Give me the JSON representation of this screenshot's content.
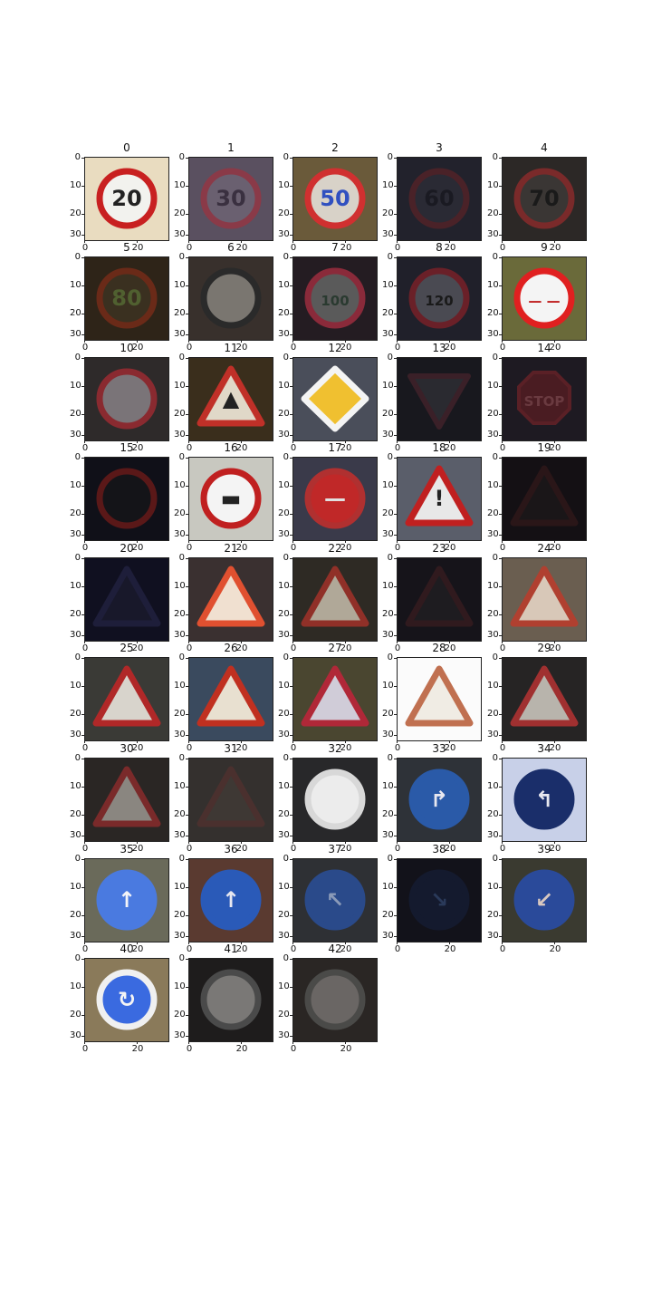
{
  "figure": {
    "yticks": [
      "0",
      "10",
      "20",
      "30"
    ],
    "xticks": [
      "0",
      "20"
    ]
  },
  "panels": [
    {
      "title": "0",
      "bg": "#e9dcc0",
      "shape": "circle",
      "rim": "#c82020",
      "fill": "#f2f2ee",
      "glyph": "20",
      "glyph_color": "#222222"
    },
    {
      "title": "1",
      "bg": "#5a5060",
      "shape": "circle",
      "rim": "#8a3a48",
      "fill": "#6a6070",
      "glyph": "30",
      "glyph_color": "#3a3040"
    },
    {
      "title": "2",
      "bg": "#6a5a3a",
      "shape": "circle",
      "rim": "#d03030",
      "fill": "#d8d2c8",
      "glyph": "50",
      "glyph_color": "#3050c0"
    },
    {
      "title": "3",
      "bg": "#22222c",
      "shape": "circle",
      "rim": "#4a2228",
      "fill": "#2a2a34",
      "glyph": "60",
      "glyph_color": "#1a1a22"
    },
    {
      "title": "4",
      "bg": "#2c2826",
      "shape": "circle",
      "rim": "#7a2a2a",
      "fill": "#3a3634",
      "glyph": "70",
      "glyph_color": "#1a1a1a"
    },
    {
      "title": "5",
      "bg": "#2e2418",
      "shape": "circle",
      "rim": "#6a2a18",
      "fill": "#3a3020",
      "glyph": "80",
      "glyph_color": "#506030"
    },
    {
      "title": "6",
      "bg": "#38302c",
      "shape": "circle",
      "rim": "#2a2a2a",
      "fill": "#7a7670",
      "glyph": "",
      "glyph_color": "#222222"
    },
    {
      "title": "7",
      "bg": "#241c22",
      "shape": "circle",
      "rim": "#8a2a3a",
      "fill": "#5a5a5a",
      "glyph": "100",
      "glyph_color": "#2a3a30"
    },
    {
      "title": "8",
      "bg": "#20202a",
      "shape": "circle",
      "rim": "#6a2028",
      "fill": "#4a4a52",
      "glyph": "120",
      "glyph_color": "#1a1a1a"
    },
    {
      "title": "9",
      "bg": "#6a6a3a",
      "shape": "circle",
      "rim": "#e02020",
      "fill": "#f4f4f4",
      "glyph": "— —",
      "glyph_color": "#c02020"
    },
    {
      "title": "10",
      "bg": "#2e2a2a",
      "shape": "circle",
      "rim": "#8a2a30",
      "fill": "#7a7478",
      "glyph": "",
      "glyph_color": "#222222"
    },
    {
      "title": "11",
      "bg": "#3a2e1c",
      "shape": "triangle",
      "rim": "#c03028",
      "fill": "#e0d8c8",
      "glyph": "▲",
      "glyph_color": "#222222"
    },
    {
      "title": "12",
      "bg": "#4a4e5a",
      "shape": "diamond",
      "rim": "#f4f4f4",
      "fill": "#f0c030",
      "glyph": "",
      "glyph_color": "#222222"
    },
    {
      "title": "13",
      "bg": "#18181e",
      "shape": "triangle-down",
      "rim": "#3a2028",
      "fill": "#2a2a30",
      "glyph": "",
      "glyph_color": "#222222"
    },
    {
      "title": "14",
      "bg": "#1e1a22",
      "shape": "octagon",
      "rim": "#5a2026",
      "fill": "#4a1c22",
      "glyph": "STOP",
      "glyph_color": "#6a3a40"
    },
    {
      "title": "15",
      "bg": "#101018",
      "shape": "circle",
      "rim": "#5a1818",
      "fill": "#141418",
      "glyph": "",
      "glyph_color": "#222222"
    },
    {
      "title": "16",
      "bg": "#c8c8c0",
      "shape": "circle",
      "rim": "#c02020",
      "fill": "#f4f4f4",
      "glyph": "▬",
      "glyph_color": "#222222"
    },
    {
      "title": "17",
      "bg": "#3a3a4a",
      "shape": "circle",
      "rim": "#b03030",
      "fill": "#c02828",
      "glyph": "—",
      "glyph_color": "#e0e0e0"
    },
    {
      "title": "18",
      "bg": "#5a5e6a",
      "shape": "triangle",
      "rim": "#c02020",
      "fill": "#e8e8e8",
      "glyph": "!",
      "glyph_color": "#222222"
    },
    {
      "title": "19",
      "bg": "#141014",
      "shape": "triangle",
      "rim": "#2a1618",
      "fill": "#1a1618",
      "glyph": "",
      "glyph_color": "#222222"
    },
    {
      "title": "20",
      "bg": "#101020",
      "shape": "triangle",
      "rim": "#1e1e3a",
      "fill": "#18182a",
      "glyph": "",
      "glyph_color": "#222222"
    },
    {
      "title": "21",
      "bg": "#3a3030",
      "shape": "triangle",
      "rim": "#e05030",
      "fill": "#f0e0d0",
      "glyph": "",
      "glyph_color": "#222222"
    },
    {
      "title": "22",
      "bg": "#2e2a24",
      "shape": "triangle",
      "rim": "#903028",
      "fill": "#b0a898",
      "glyph": "",
      "glyph_color": "#222222"
    },
    {
      "title": "23",
      "bg": "#16141a",
      "shape": "triangle",
      "rim": "#301a1e",
      "fill": "#1e1c20",
      "glyph": "",
      "glyph_color": "#222222"
    },
    {
      "title": "24",
      "bg": "#6a5e50",
      "shape": "triangle",
      "rim": "#b04030",
      "fill": "#d8c8b8",
      "glyph": "",
      "glyph_color": "#222222"
    },
    {
      "title": "25",
      "bg": "#3a3a36",
      "shape": "triangle",
      "rim": "#b02828",
      "fill": "#d8d4cc",
      "glyph": "",
      "glyph_color": "#222222"
    },
    {
      "title": "26",
      "bg": "#3a4a5e",
      "shape": "triangle",
      "rim": "#c03020",
      "fill": "#e8e0d0",
      "glyph": "",
      "glyph_color": "#222222"
    },
    {
      "title": "27",
      "bg": "#4a4630",
      "shape": "triangle",
      "rim": "#b02838",
      "fill": "#d0ccd8",
      "glyph": "",
      "glyph_color": "#222222"
    },
    {
      "title": "28",
      "bg": "#fbfbfb",
      "shape": "triangle",
      "rim": "#c07050",
      "fill": "#f0ece4",
      "glyph": "",
      "glyph_color": "#4060a0"
    },
    {
      "title": "29",
      "bg": "#262424",
      "shape": "triangle",
      "rim": "#a03030",
      "fill": "#b8b4ac",
      "glyph": "",
      "glyph_color": "#222222"
    },
    {
      "title": "30",
      "bg": "#2a2624",
      "shape": "triangle",
      "rim": "#7a2a2a",
      "fill": "#8a8680",
      "glyph": "",
      "glyph_color": "#222222"
    },
    {
      "title": "31",
      "bg": "#34302e",
      "shape": "triangle",
      "rim": "#4a302e",
      "fill": "#3e3834",
      "glyph": "",
      "glyph_color": "#222222"
    },
    {
      "title": "32",
      "bg": "#28282a",
      "shape": "circle",
      "rim": "#d8d8d8",
      "fill": "#ececec",
      "glyph": "",
      "glyph_color": "#222222"
    },
    {
      "title": "33",
      "bg": "#2e3238",
      "shape": "circle",
      "rim": "#2a5aa8",
      "fill": "#2a5aa8",
      "glyph": "↱",
      "glyph_color": "#e8e8f0"
    },
    {
      "title": "34",
      "bg": "#c8d0e8",
      "shape": "circle",
      "rim": "#1a2e6a",
      "fill": "#1a2e6a",
      "glyph": "↰",
      "glyph_color": "#e8e8f0"
    },
    {
      "title": "35",
      "bg": "#6a6a5a",
      "shape": "circle",
      "rim": "#4a7ae0",
      "fill": "#4a7ae0",
      "glyph": "↑",
      "glyph_color": "#f4f4f8"
    },
    {
      "title": "36",
      "bg": "#5a3a30",
      "shape": "circle",
      "rim": "#2a5ab8",
      "fill": "#2a5ab8",
      "glyph": "↑",
      "glyph_color": "#e8e8f0"
    },
    {
      "title": "37",
      "bg": "#2e3034",
      "shape": "circle",
      "rim": "#2a4a8a",
      "fill": "#2a4a8a",
      "glyph": "↖",
      "glyph_color": "#8a9ab8"
    },
    {
      "title": "38",
      "bg": "#12121a",
      "shape": "circle",
      "rim": "#141a2e",
      "fill": "#141a2e",
      "glyph": "↘",
      "glyph_color": "#2a3a5a"
    },
    {
      "title": "39",
      "bg": "#3a3a30",
      "shape": "circle",
      "rim": "#2a4a9a",
      "fill": "#2a4a9a",
      "glyph": "↙",
      "glyph_color": "#d8c8c0"
    },
    {
      "title": "40",
      "bg": "#8a7a5a",
      "shape": "circle",
      "rim": "#f0f0f0",
      "fill": "#3a6ae0",
      "glyph": "↻",
      "glyph_color": "#f4f4f4"
    },
    {
      "title": "41",
      "bg": "#1e1c1c",
      "shape": "circle",
      "rim": "#4a4a4a",
      "fill": "#7a7876",
      "glyph": "",
      "glyph_color": "#222222"
    },
    {
      "title": "42",
      "bg": "#2a2624",
      "shape": "circle",
      "rim": "#4a4a48",
      "fill": "#6a6664",
      "glyph": "",
      "glyph_color": "#222222"
    }
  ]
}
